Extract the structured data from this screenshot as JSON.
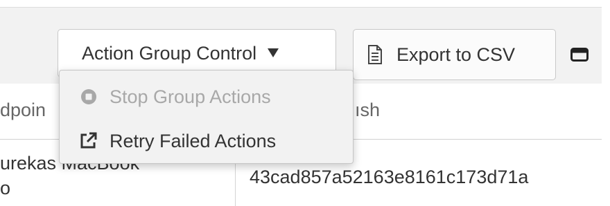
{
  "toolbar": {
    "action_group_label": "Action Group Control",
    "export_label": "Export to CSV"
  },
  "dropdown": {
    "items": [
      {
        "label": "Stop Group Actions",
        "icon": "stop-circle-icon",
        "disabled": true
      },
      {
        "label": "Retry Failed Actions",
        "icon": "external-link-icon",
        "disabled": false
      }
    ]
  },
  "table": {
    "headers": [
      "dpoin",
      "ısh"
    ],
    "row": {
      "endpoint_line1": "urekas MacBook",
      "endpoint_line2": "o",
      "hash": "43cad857a52163e8161c173d71a"
    }
  },
  "colors": {
    "toolbar_bg": "#f2f2f2",
    "menu_bg": "#f2f2f2",
    "disabled_text": "#a8a8a8",
    "text": "#333333"
  }
}
